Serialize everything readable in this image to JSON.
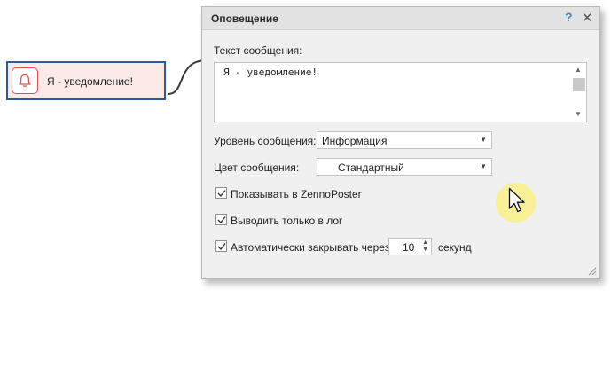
{
  "canvas": {
    "node": {
      "label": "Я - уведомление!",
      "icon": "bell-icon",
      "border_color": "#2e5a93",
      "fill_color": "#fbeae8",
      "icon_color": "#d9534f"
    }
  },
  "dialog": {
    "title": "Оповещение",
    "help_label": "?",
    "close_label": "✕",
    "message": {
      "label": "Текст сообщения:",
      "value": "Я - уведомление!"
    },
    "level": {
      "label": "Уровень сообщения:",
      "value": "Информация"
    },
    "color": {
      "label": "Цвет сообщения:",
      "value": "Стандартный"
    },
    "options": {
      "show_in_zennoposter": {
        "label": "Показывать в ZennoPoster",
        "checked": true
      },
      "log_only": {
        "label": "Выводить только в лог",
        "checked": true
      },
      "auto_close": {
        "label": "Автоматически закрывать через",
        "checked": true
      }
    },
    "auto_close_seconds": "10",
    "seconds_unit": "секунд"
  }
}
